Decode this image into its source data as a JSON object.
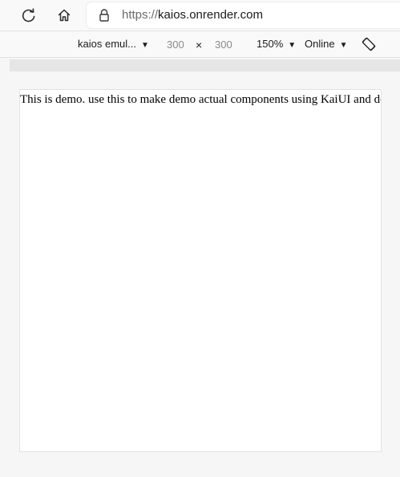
{
  "browser": {
    "url_scheme": "https://",
    "url_host": "kaios.onrender.com"
  },
  "devtools": {
    "device_label": "kaios emul...",
    "width_value": "300",
    "height_value": "300",
    "dimension_separator": "×",
    "zoom_label": "150%",
    "network_label": "Online",
    "caret": "▼"
  },
  "page": {
    "demo_text": "This is demo. use this to make demo actual components using KaiUI and deploy"
  },
  "icons": {
    "reload": "reload-icon",
    "home": "home-icon",
    "lock": "lock-icon",
    "rotate": "rotate-viewport-icon"
  }
}
